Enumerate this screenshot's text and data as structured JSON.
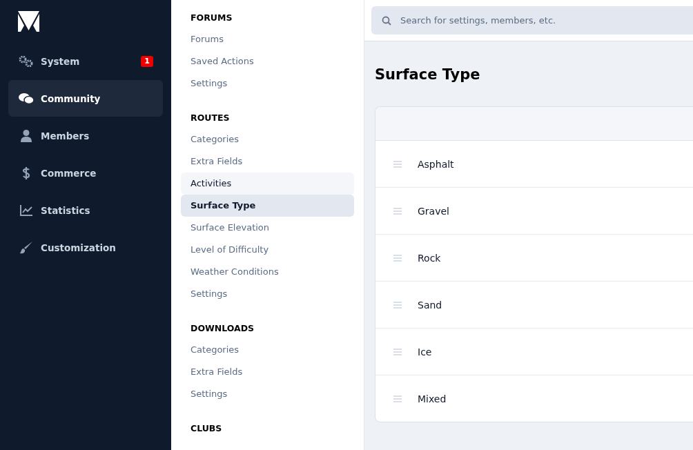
{
  "nav": [
    {
      "label": "System",
      "kind": "gears",
      "selected": false,
      "badge": "1"
    },
    {
      "label": "Community",
      "kind": "chat",
      "selected": true
    },
    {
      "label": "Members",
      "kind": "person",
      "selected": false
    },
    {
      "label": "Commerce",
      "kind": "dollar",
      "selected": false
    },
    {
      "label": "Statistics",
      "kind": "chart",
      "selected": false
    },
    {
      "label": "Customization",
      "kind": "brush",
      "selected": false
    }
  ],
  "subnav": [
    {
      "heading": "FORUMS",
      "items": [
        {
          "label": "Forums",
          "selected": false,
          "hovered": false
        },
        {
          "label": "Saved Actions",
          "selected": false,
          "hovered": false
        },
        {
          "label": "Settings",
          "selected": false,
          "hovered": false
        }
      ]
    },
    {
      "heading": "ROUTES",
      "items": [
        {
          "label": "Categories",
          "selected": false,
          "hovered": false
        },
        {
          "label": "Extra Fields",
          "selected": false,
          "hovered": false
        },
        {
          "label": "Activities",
          "selected": false,
          "hovered": true
        },
        {
          "label": "Surface Type",
          "selected": true,
          "hovered": false
        },
        {
          "label": "Surface Elevation",
          "selected": false,
          "hovered": false
        },
        {
          "label": "Level of Difficulty",
          "selected": false,
          "hovered": false
        },
        {
          "label": "Weather Conditions",
          "selected": false,
          "hovered": false
        },
        {
          "label": "Settings",
          "selected": false,
          "hovered": false
        }
      ]
    },
    {
      "heading": "DOWNLOADS",
      "items": [
        {
          "label": "Categories",
          "selected": false,
          "hovered": false
        },
        {
          "label": "Extra Fields",
          "selected": false,
          "hovered": false
        },
        {
          "label": "Settings",
          "selected": false,
          "hovered": false
        }
      ]
    },
    {
      "heading": "CLUBS"
    }
  ],
  "search": {
    "placeholder": "Search for settings, members, etc."
  },
  "page_title": "Surface Type",
  "rows": [
    "Asphalt",
    "Gravel",
    "Rock",
    "Sand",
    "Ice",
    "Mixed"
  ]
}
